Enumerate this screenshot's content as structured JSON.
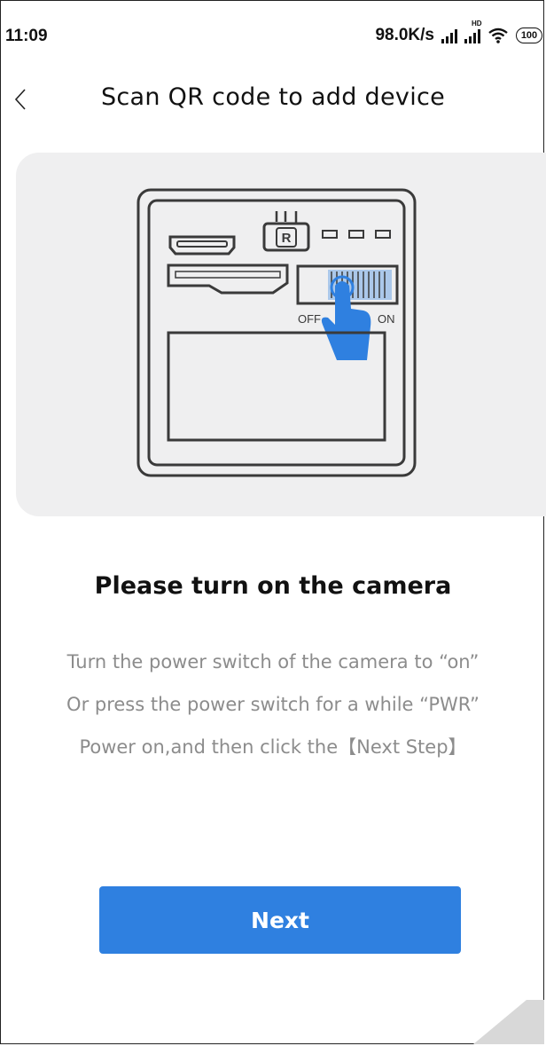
{
  "status_bar": {
    "time": "11:09",
    "network_speed": "98.0K/s",
    "signal_2_label": "HD",
    "battery": "100"
  },
  "header": {
    "back_icon": "chevron-left-icon",
    "title": "Scan QR code to add device"
  },
  "illustration": {
    "port_label": "R",
    "switch_off_label": "OFF",
    "switch_on_label": "ON",
    "hand_color": "#2f80e0"
  },
  "instructions": {
    "title": "Please turn on the camera",
    "lines": [
      "Turn the power switch of the camera to “on”",
      "Or press the power switch for a while “PWR”",
      "Power on,and then click the【Next Step】"
    ]
  },
  "actions": {
    "next_label": "Next"
  },
  "colors": {
    "accent": "#2f80e0",
    "card_background": "#efeff0",
    "body_text": "#8c8c8c"
  }
}
